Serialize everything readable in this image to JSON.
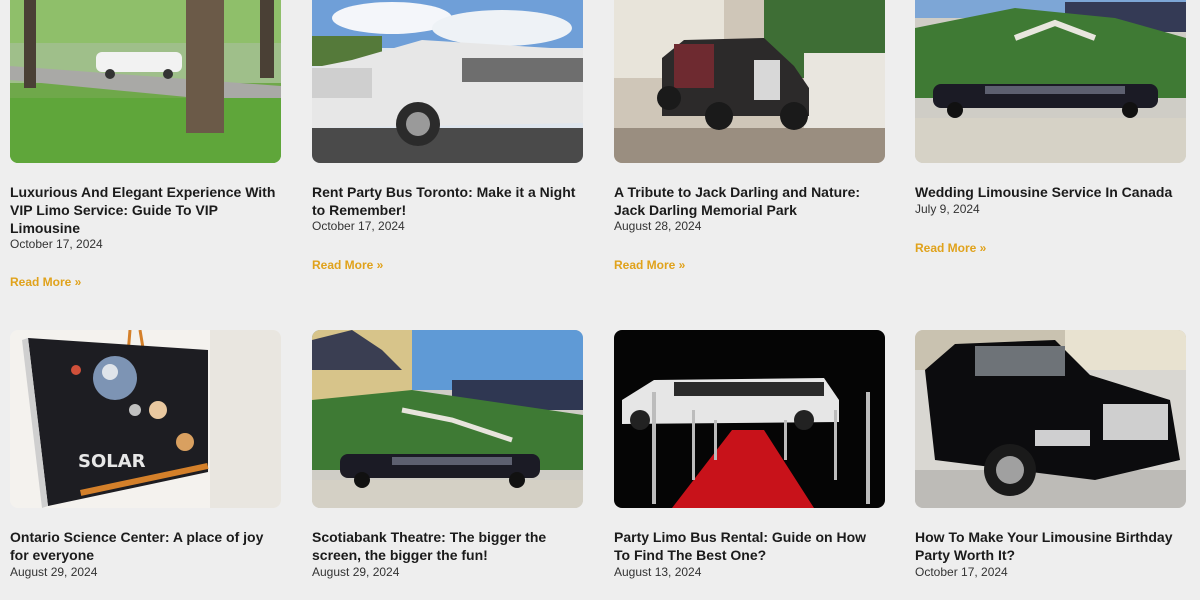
{
  "posts": [
    {
      "title": "Luxurious And Elegant Experience With VIP Limo Service: Guide To VIP Limousine",
      "date": "October 17, 2024",
      "read_more": "Read More »",
      "image": "white-limo-park"
    },
    {
      "title": "Rent Party Bus Toronto: Make it a Night to Remember!",
      "date": "October 17, 2024",
      "read_more": "Read More »",
      "image": "white-escalade-limo"
    },
    {
      "title": "A Tribute to Jack Darling and Nature: Jack Darling Memorial Park",
      "date": "August 28, 2024",
      "read_more": "Read More »",
      "image": "vintage-rolls-royce"
    },
    {
      "title": "Wedding Limousine Service In Canada",
      "date": "July 9, 2024",
      "read_more": "Read More »",
      "image": "black-limo-garden"
    },
    {
      "title": "Ontario Science Center: A place of joy for everyone",
      "date": "August 29, 2024",
      "image": "solar-system-easel"
    },
    {
      "title": "Scotiabank Theatre: The bigger the screen, the bigger the fun!",
      "date": "August 29, 2024",
      "image": "black-limo-chateau"
    },
    {
      "title": "Party Limo Bus Rental: Guide on How To Find The Best One?",
      "date": "August 13, 2024",
      "image": "white-limo-red-carpet"
    },
    {
      "title": "How To Make Your Limousine Birthday Party Worth It?",
      "date": "October 17, 2024",
      "image": "black-lincoln-limo"
    }
  ],
  "colors": {
    "accent": "#e0a21b",
    "background": "#eeeeee",
    "title": "#1b1b1b"
  }
}
